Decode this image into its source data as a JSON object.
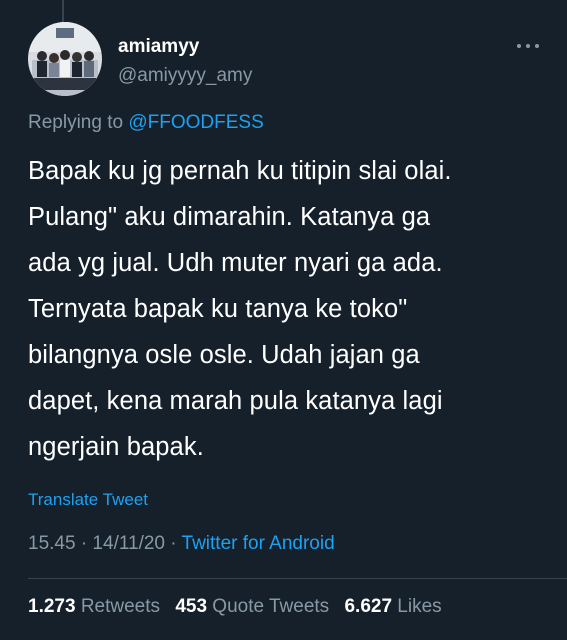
{
  "tweet": {
    "author": {
      "display_name": "amiamyy",
      "handle": "@amiyyyy_amy",
      "avatar_icon": "group-photo-avatar"
    },
    "reply": {
      "prefix": "Replying to",
      "mention": "@FFOODFESS"
    },
    "text_lines": [
      "Bapak ku jg pernah ku titipin slai olai.",
      "Pulang\" aku dimarahin. Katanya ga",
      "ada yg jual. Udh muter nyari ga ada.",
      "Ternyata bapak ku tanya ke toko\"",
      "bilangnya osle osle. Udah jajan ga",
      "dapet, kena marah pula katanya lagi",
      "ngerjain bapak."
    ],
    "translate_label": "Translate Tweet",
    "timestamp": "15.45 · 14/11/20",
    "separator": " · ",
    "source": "Twitter for Android",
    "stats": {
      "retweets_count": "1.273",
      "retweets_label": "Retweets",
      "quotes_count": "453",
      "quotes_label": "Quote Tweets",
      "likes_count": "6.627",
      "likes_label": "Likes"
    }
  },
  "colors": {
    "background": "#15202b",
    "text": "#ffffff",
    "secondary": "#8899a6",
    "accent": "#1da1f2",
    "divider": "#38444d"
  }
}
